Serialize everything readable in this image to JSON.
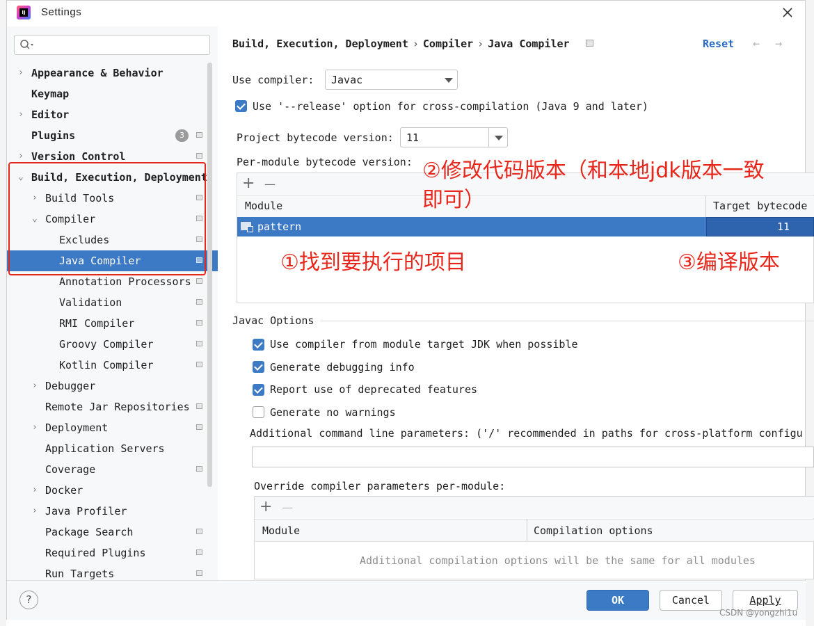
{
  "window": {
    "title": "Settings"
  },
  "search": {
    "placeholder": ""
  },
  "tree": [
    {
      "label": "Appearance & Behavior",
      "bold": true,
      "chevron": "›",
      "level": 0,
      "settings_icon": false
    },
    {
      "label": "Keymap",
      "bold": true,
      "chevron": "",
      "level": 0,
      "settings_icon": false
    },
    {
      "label": "Editor",
      "bold": true,
      "chevron": "›",
      "level": 0,
      "settings_icon": false
    },
    {
      "label": "Plugins",
      "bold": true,
      "chevron": "",
      "level": 0,
      "settings_icon": true,
      "badge": "3"
    },
    {
      "label": "Version Control",
      "bold": true,
      "chevron": "›",
      "level": 0,
      "settings_icon": true
    },
    {
      "label": "Build, Execution, Deployment",
      "bold": true,
      "chevron": "⌄",
      "level": 0,
      "settings_icon": false
    },
    {
      "label": "Build Tools",
      "bold": false,
      "chevron": "›",
      "level": 1,
      "settings_icon": true
    },
    {
      "label": "Compiler",
      "bold": false,
      "chevron": "⌄",
      "level": 1,
      "settings_icon": true
    },
    {
      "label": "Excludes",
      "bold": false,
      "chevron": "",
      "level": 2,
      "settings_icon": true
    },
    {
      "label": "Java Compiler",
      "bold": false,
      "chevron": "",
      "level": 2,
      "settings_icon": true,
      "selected": true
    },
    {
      "label": "Annotation Processors",
      "bold": false,
      "chevron": "",
      "level": 2,
      "settings_icon": true
    },
    {
      "label": "Validation",
      "bold": false,
      "chevron": "",
      "level": 2,
      "settings_icon": true
    },
    {
      "label": "RMI Compiler",
      "bold": false,
      "chevron": "",
      "level": 2,
      "settings_icon": true
    },
    {
      "label": "Groovy Compiler",
      "bold": false,
      "chevron": "",
      "level": 2,
      "settings_icon": true
    },
    {
      "label": "Kotlin Compiler",
      "bold": false,
      "chevron": "",
      "level": 2,
      "settings_icon": true
    },
    {
      "label": "Debugger",
      "bold": false,
      "chevron": "›",
      "level": 1,
      "settings_icon": false
    },
    {
      "label": "Remote Jar Repositories",
      "bold": false,
      "chevron": "",
      "level": 1,
      "settings_icon": true
    },
    {
      "label": "Deployment",
      "bold": false,
      "chevron": "›",
      "level": 1,
      "settings_icon": true
    },
    {
      "label": "Application Servers",
      "bold": false,
      "chevron": "",
      "level": 1,
      "settings_icon": false
    },
    {
      "label": "Coverage",
      "bold": false,
      "chevron": "",
      "level": 1,
      "settings_icon": true
    },
    {
      "label": "Docker",
      "bold": false,
      "chevron": "›",
      "level": 1,
      "settings_icon": false
    },
    {
      "label": "Java Profiler",
      "bold": false,
      "chevron": "›",
      "level": 1,
      "settings_icon": false
    },
    {
      "label": "Package Search",
      "bold": false,
      "chevron": "",
      "level": 1,
      "settings_icon": true
    },
    {
      "label": "Required Plugins",
      "bold": false,
      "chevron": "",
      "level": 1,
      "settings_icon": true
    },
    {
      "label": "Run Targets",
      "bold": false,
      "chevron": "",
      "level": 1,
      "settings_icon": true
    }
  ],
  "breadcrumb": [
    "Build, Execution, Deployment",
    "Compiler",
    "Java Compiler"
  ],
  "breadcrumb_sep": "›",
  "reset_label": "Reset",
  "nav": {
    "back": "←",
    "forward": "→"
  },
  "use_compiler": {
    "label": "Use compiler:",
    "value": "Javac"
  },
  "release_option": {
    "label": "Use '--release' option for cross-compilation (Java 9 and later)",
    "checked": true
  },
  "project_bytecode": {
    "label": "Project bytecode version:",
    "value": "11"
  },
  "per_module": {
    "label": "Per-module bytecode version:",
    "add": "+",
    "remove": "—",
    "columns": [
      "Module",
      "Target bytecode"
    ],
    "rows": [
      {
        "module": "pattern",
        "target": "11"
      }
    ]
  },
  "annotations": {
    "a1": "①找到要执行的项目",
    "a2_line1": "②修改代码版本（和本地jdk版本一致",
    "a2_line2": "即可）",
    "a3": "③编译版本"
  },
  "javac_options": {
    "title": "Javac Options",
    "checkboxes": [
      {
        "label": "Use compiler from module target JDK when possible",
        "checked": true
      },
      {
        "label": "Generate debugging info",
        "checked": true
      },
      {
        "label": "Report use of deprecated features",
        "checked": true
      },
      {
        "label": "Generate no warnings",
        "checked": false
      }
    ],
    "additional_params_label": "Additional command line parameters:  ('/' recommended in paths for cross-platform configu",
    "additional_params_value": ""
  },
  "override": {
    "label": "Override compiler parameters per-module:",
    "add": "+",
    "remove": "—",
    "columns": [
      "Module",
      "Compilation options"
    ],
    "empty_text": "Additional compilation options will be the same for all modules"
  },
  "footer": {
    "help": "?",
    "ok": "OK",
    "cancel": "Cancel",
    "apply": "Apply"
  },
  "watermark": "CSDN @yongzhi1u",
  "colors": {
    "accent": "#3d7ac6",
    "link": "#2a6ac4",
    "annotation": "#e8271c"
  }
}
